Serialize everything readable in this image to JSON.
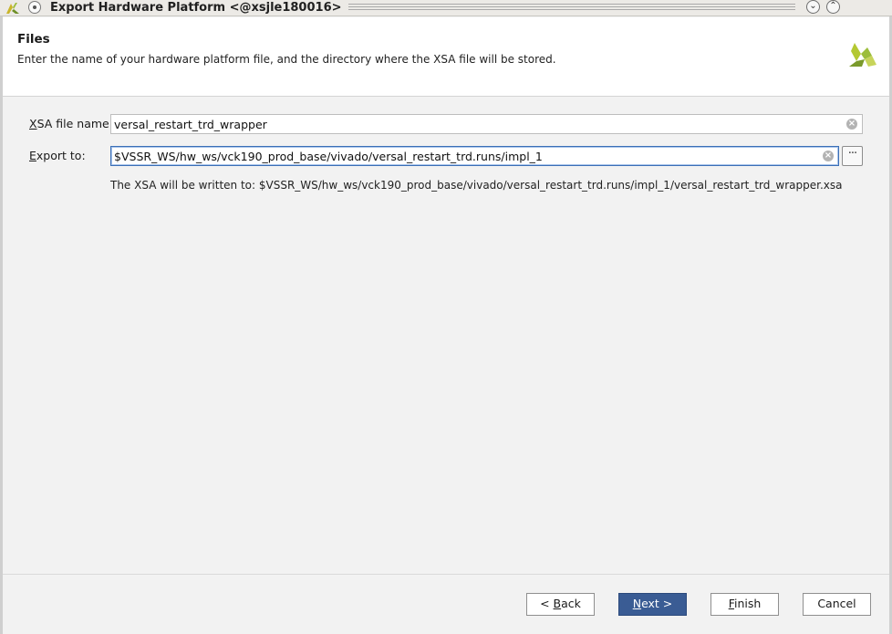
{
  "window": {
    "title": "Export Hardware Platform <@xsjle180016>",
    "minimize_glyph": "⌄",
    "maximize_glyph": "⌃"
  },
  "header": {
    "title": "Files",
    "description": "Enter the name of your hardware platform file, and the directory where the XSA file will be stored."
  },
  "form": {
    "xsa_label_mnemonic": "X",
    "xsa_label_rest": "SA file name:",
    "xsa_value": "versal_restart_trd_wrapper",
    "export_label_mnemonic": "E",
    "export_label_rest": "xport to:",
    "export_value": "$VSSR_WS/hw_ws/vck190_prod_base/vivado/versal_restart_trd.runs/impl_1",
    "browse_label": "···",
    "clear_glyph": "×",
    "written_to": "The XSA will be written to: $VSSR_WS/hw_ws/vck190_prod_base/vivado/versal_restart_trd.runs/impl_1/versal_restart_trd_wrapper.xsa"
  },
  "buttons": {
    "back_prefix": "< ",
    "back_mnemonic": "B",
    "back_rest": "ack",
    "next_mnemonic": "N",
    "next_rest": "ext >",
    "finish_mnemonic": "F",
    "finish_rest": "inish",
    "cancel": "Cancel"
  },
  "colors": {
    "primary_button": "#3a5c94",
    "logo_green": "#9cbd3b"
  },
  "icons": {
    "app": "xilinx-logo-icon",
    "brand": "xilinx-logo-icon",
    "clear": "clear-circle-icon"
  }
}
